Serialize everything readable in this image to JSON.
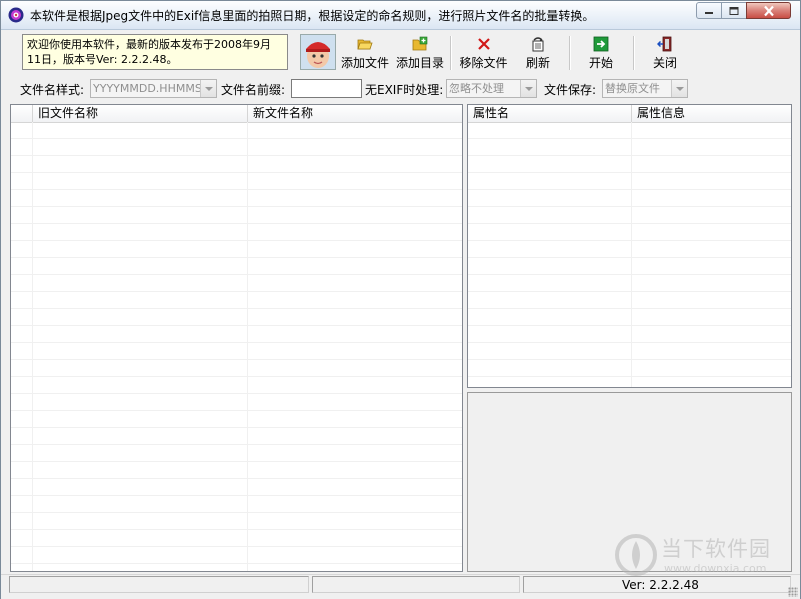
{
  "window": {
    "title": "本软件是根据Jpeg文件中的Exif信息里面的拍照日期，根据设定的命名规则，进行照片文件名的批量转换。"
  },
  "toolbar": {
    "info_line1": "欢迎你使用本软件，最新的版本发布于2008年9月",
    "info_line2": "11日，版本号Ver: 2.2.2.48。",
    "buttons": [
      {
        "label": "添加文件",
        "icon": "open-folder-icon"
      },
      {
        "label": "添加目录",
        "icon": "add-folder-icon"
      },
      {
        "label": "移除文件",
        "icon": "red-x-icon"
      },
      {
        "label": "刷新",
        "icon": "refresh-icon"
      },
      {
        "label": "开始",
        "icon": "green-arrow-icon"
      },
      {
        "label": "关闭",
        "icon": "exit-door-icon"
      }
    ]
  },
  "options": {
    "format_label": "文件名样式:",
    "format_value": "YYYYMMDD.HHMMSS",
    "prefix_label": "文件名前缀:",
    "prefix_value": "",
    "noexif_label": "无EXIF时处理:",
    "noexif_value": "忽略不处理",
    "save_label": "文件保存:",
    "save_value": "替换原文件"
  },
  "file_list": {
    "columns": [
      "旧文件名称",
      "新文件名称"
    ]
  },
  "property_list": {
    "columns": [
      "属性名",
      "属性信息"
    ]
  },
  "statusbar": {
    "cell1": "",
    "cell2": "",
    "version": "Ver: 2.2.2.48"
  },
  "watermark": {
    "text": "当下软件园",
    "url": "www.downxia.com"
  },
  "colors": {
    "close_button": "#c94d44",
    "info_box_bg": "#ffffe1",
    "window_bg": "#f0f0f0"
  }
}
